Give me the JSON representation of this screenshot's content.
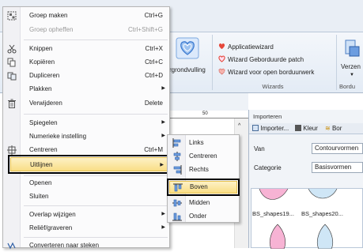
{
  "ribbon": {
    "wizards": [
      {
        "label": "Applicatiewizard",
        "icon": "heart-icon"
      },
      {
        "label": "Wizard Geborduurde patch",
        "icon": "heart-outline-icon"
      },
      {
        "label": "Wizard voor open borduurwerk",
        "icon": "heart-lace-icon"
      }
    ],
    "wizards_group_label": "Wizards",
    "background_label": "rgrondvulling",
    "right_button_label": "Verzen",
    "right_group_label": "Bordu"
  },
  "ruler": {
    "mark": "50"
  },
  "panel": {
    "title": "Importeren",
    "tabs": [
      {
        "label": "Importer..."
      },
      {
        "label": "Kleur"
      },
      {
        "label": "Bor"
      }
    ],
    "from_label": "Van",
    "from_value": "Contourvormen",
    "category_label": "Categorie",
    "category_value": "Basisvormen",
    "thumbs": [
      "BS_shapes19...",
      "BS_shapes20..."
    ]
  },
  "menu": {
    "items": [
      {
        "label": "Groep maken",
        "shortcut": "Ctrl+G",
        "icon": "group-icon"
      },
      {
        "label": "Groep opheffen",
        "shortcut": "Ctrl+Shift+G",
        "disabled": true
      },
      {
        "label": "Knippen",
        "shortcut": "Ctrl+X",
        "icon": "scissors-icon"
      },
      {
        "label": "Kopiëren",
        "shortcut": "Ctrl+C",
        "icon": "copy-icon"
      },
      {
        "label": "Dupliceren",
        "shortcut": "Ctrl+D",
        "icon": "duplicate-icon"
      },
      {
        "label": "Plakken"
      },
      {
        "label": "Verwijderen",
        "shortcut": "Delete",
        "icon": "trash-icon"
      },
      {
        "label": "Spiegelen"
      },
      {
        "label": "Numerieke instelling"
      },
      {
        "label": "Centreren",
        "shortcut": "Ctrl+M"
      },
      {
        "label": "Uitlijnen"
      },
      {
        "label": "Openen"
      },
      {
        "label": "Sluiten"
      },
      {
        "label": "Overlap wijzigen"
      },
      {
        "label": "Reliëf/graveren"
      },
      {
        "label": "Converteren naar steken"
      }
    ]
  },
  "submenu": {
    "items": [
      {
        "label": "Links",
        "icon": "align-left-icon"
      },
      {
        "label": "Centreren",
        "icon": "align-center-icon"
      },
      {
        "label": "Rechts",
        "icon": "align-right-icon"
      },
      {
        "label": "Boven",
        "icon": "align-top-icon"
      },
      {
        "label": "Midden",
        "icon": "align-middle-icon"
      },
      {
        "label": "Onder",
        "icon": "align-bottom-icon"
      }
    ]
  }
}
